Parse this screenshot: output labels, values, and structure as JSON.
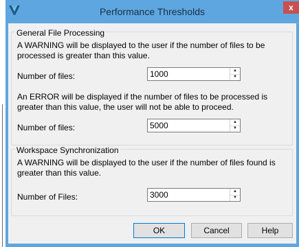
{
  "window": {
    "title": "Performance Thresholds",
    "close_label": "x"
  },
  "general_file_processing": {
    "legend": "General File Processing",
    "warning_text": "A WARNING will be displayed to the user if the number of files to be processed is greater than this value.",
    "warning_label": "Number of files:",
    "warning_value": "1000",
    "error_text": "An ERROR will be displayed if the number of files to be processed is greater than this value, the user will not be able to proceed.",
    "error_label": "Number of files:",
    "error_value": "5000"
  },
  "workspace_synchronization": {
    "legend": "Workspace Synchronization",
    "warning_text": "A WARNING will be displayed to the user if the number of files found is greater than this value.",
    "warning_label": "Number of Files:",
    "warning_value": "3000"
  },
  "buttons": {
    "ok": "OK",
    "cancel": "Cancel",
    "help": "Help"
  },
  "colors": {
    "title_bar": "#5ea6e0",
    "close_button": "#c75050",
    "dialog_background": "#f0f0f0"
  },
  "icons": {
    "app": "app-logo-icon",
    "spin_up": "chevron-up-icon",
    "spin_down": "chevron-down-icon"
  }
}
